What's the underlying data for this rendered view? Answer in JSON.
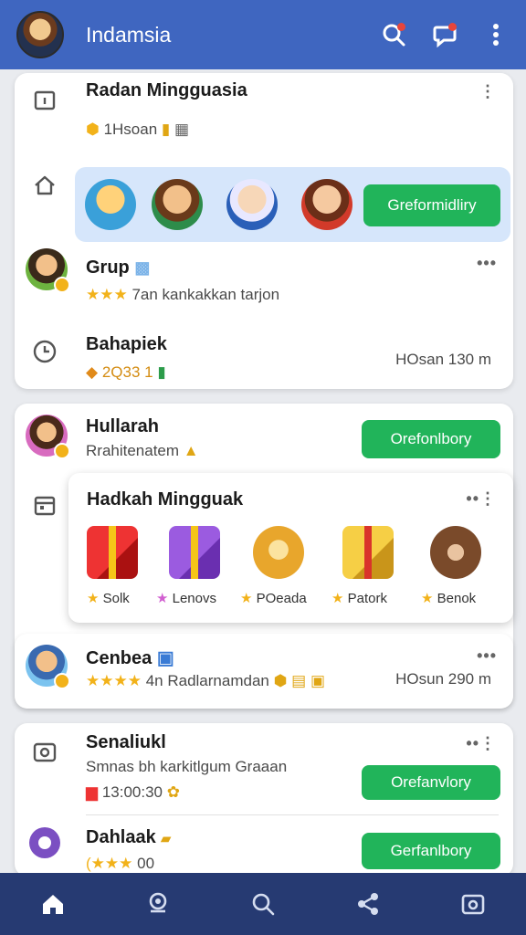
{
  "app": {
    "title": "Indamsia"
  },
  "card1": {
    "section_title": "Radan Mingguasia",
    "section_sub": "1Hsoan",
    "strip_button": "Greformidliry",
    "group": {
      "title": "Grup",
      "sub": "7an kankakkan tarjon"
    },
    "history": {
      "title": "Bahapiek",
      "sub": "2Q33 1",
      "right": "HOsan 130 m"
    }
  },
  "card2": {
    "user": {
      "title": "Hullarah",
      "sub": "Rrahitenatem",
      "button": "Orefonlbory"
    },
    "popup": {
      "title": "Hadkah Mingguak",
      "gifts": [
        {
          "label": "Solk",
          "icon": "gift-red-icon",
          "star": "#f2b21a"
        },
        {
          "label": "Lenovs",
          "icon": "gift-purple-icon",
          "star": "#d15fd0"
        },
        {
          "label": "POeada",
          "icon": "bear-yellow-icon",
          "star": "#f2b21a"
        },
        {
          "label": "Patork",
          "icon": "gift-gold-icon",
          "star": "#f2b21a"
        },
        {
          "label": "Benok",
          "icon": "bear-brown-icon",
          "star": "#f2b21a"
        }
      ]
    }
  },
  "card3": {
    "title": "Cenbea",
    "sub": "4n Radlarnamdan",
    "right": "HOsun 290 m"
  },
  "card4": {
    "item1": {
      "title": "Senaliukl",
      "sub": "Smnas bh karkitlgum Graaan",
      "sub2": "13:00:30",
      "button": "Orefanvlory"
    },
    "item2": {
      "title": "Dahlaak",
      "sub": "00",
      "button": "Gerfanlbory"
    }
  },
  "colors": {
    "appbar": "#3f66c0",
    "accent_green": "#21b45a",
    "bottom_nav": "#263a72",
    "star": "#f2b21a"
  }
}
